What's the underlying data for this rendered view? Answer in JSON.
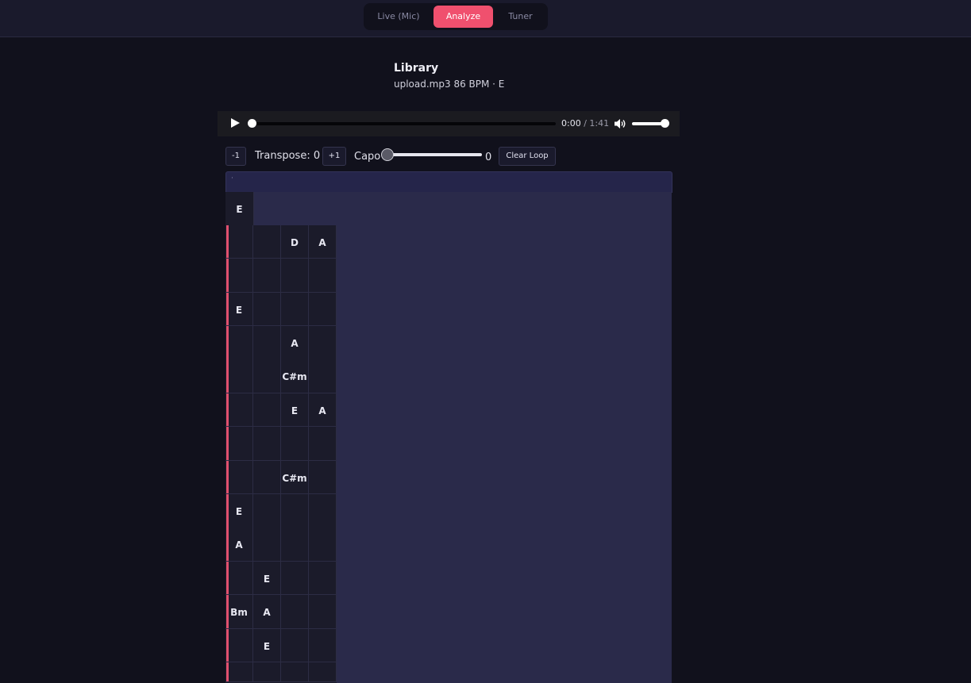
{
  "nav": {
    "tabs": [
      {
        "label": "Live (Mic)"
      },
      {
        "label": "Analyze"
      },
      {
        "label": "Tuner"
      }
    ],
    "active": "Analyze"
  },
  "library": {
    "title": "Library",
    "meta": "upload.mp3 86 BPM · E"
  },
  "player": {
    "current": "0:00",
    "separator": "/",
    "duration": "1:41",
    "progress": 0,
    "volume": 1
  },
  "controls": {
    "minus_label": "-1",
    "transpose_label": "Transpose: 0",
    "plus_label": "+1",
    "capo_label": "Capo",
    "capo_value": "0",
    "clear_loop_label": "Clear Loop"
  },
  "sheet": {
    "header_text": "·",
    "first_chord": "E",
    "rows": [
      [
        "",
        "",
        "D",
        "A"
      ],
      [
        "",
        "",
        "",
        ""
      ],
      [
        "E",
        "",
        "",
        ""
      ],
      [
        "",
        "",
        "A\n\nC#m",
        ""
      ],
      [
        "",
        "",
        "E",
        "A"
      ],
      [
        "",
        "",
        "",
        ""
      ],
      [
        "",
        "",
        "C#m",
        ""
      ],
      [
        "E\n\nA",
        "",
        "",
        ""
      ],
      [
        "",
        "E",
        "",
        ""
      ],
      [
        "Bm",
        "A",
        "",
        ""
      ],
      [
        "",
        "E",
        "",
        ""
      ],
      [
        "",
        "",
        "",
        ""
      ]
    ]
  },
  "colors": {
    "accent": "#f0506e",
    "background": "#11111c",
    "panel": "#2a2a4a",
    "cell": "#1b1b2a"
  }
}
